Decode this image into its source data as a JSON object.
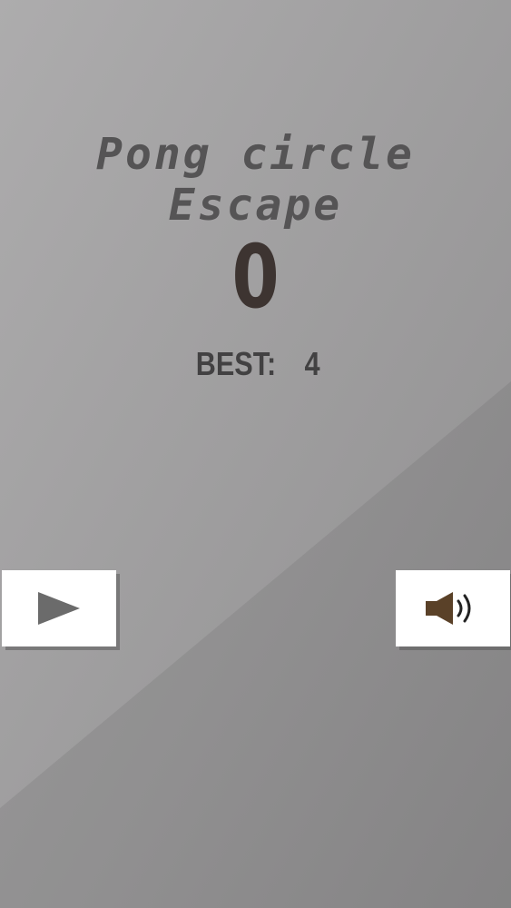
{
  "game": {
    "title_line1": "Pong circle",
    "title_line2": "Escape",
    "score": "0",
    "best_label": "BEST:",
    "best_value": "4"
  },
  "buttons": {
    "play_icon": "play-icon",
    "sound_icon": "speaker-icon"
  },
  "colors": {
    "background": "#9d9c9d",
    "title": "#555455",
    "score": "#3d3431",
    "best": "#424142",
    "button_bg": "#ffffff",
    "play_icon": "#6b6b6b",
    "speaker_icon": "#5a4128"
  }
}
